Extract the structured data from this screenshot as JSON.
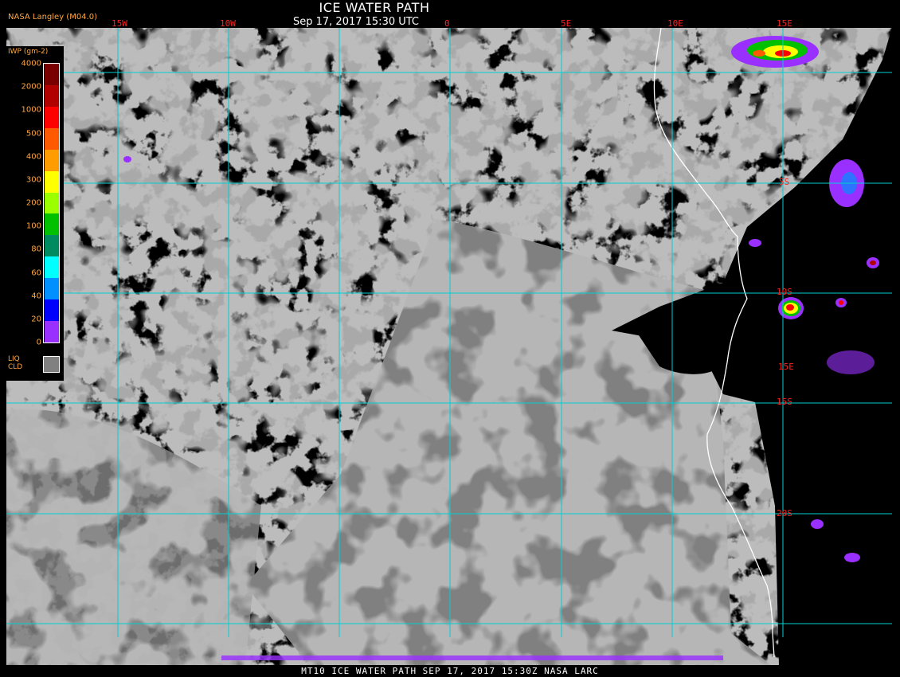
{
  "header": {
    "title": "ICE WATER PATH",
    "subtitle": "Sep 17, 2017 15:30 UTC",
    "agency": "NASA Langley (M04.0)"
  },
  "footer": "MT10  ICE WATER PATH  SEP 17, 2017 15:30Z  NASA LARC",
  "legend": {
    "title": "IWP (gm-2)",
    "ticks": [
      "4000",
      "2000",
      "1000",
      "500",
      "400",
      "300",
      "200",
      "100",
      "80",
      "60",
      "40",
      "20",
      "0"
    ],
    "colors": [
      "#7a0000",
      "#b00000",
      "#ff0000",
      "#ff5a00",
      "#ff9c00",
      "#ffff00",
      "#9cff00",
      "#00c000",
      "#008a60",
      "#00ffff",
      "#0090ff",
      "#0000ff",
      "#9a30ff"
    ],
    "liq_label_1": "LIQ",
    "liq_label_2": "CLD",
    "liq_color": "#808080"
  },
  "map": {
    "grid_color": "#00d0d0",
    "coast_color": "#ffffff",
    "cloud_color": "#808080",
    "label_color": "#ff2020",
    "lon_labels": [
      "15W",
      "10W",
      "0",
      "5E",
      "10E",
      "15E"
    ],
    "lat_labels": [
      "5S",
      "10S",
      "15S",
      "20S"
    ],
    "lat_mid_label": "15E"
  }
}
